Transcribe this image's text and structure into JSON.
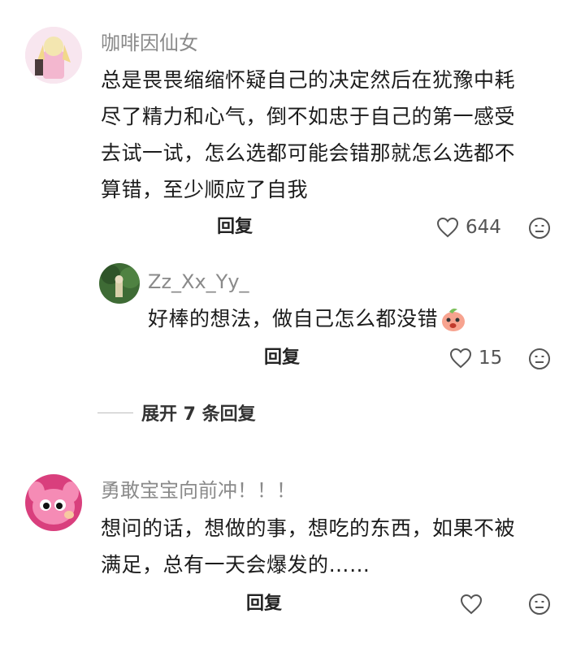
{
  "comments": [
    {
      "username": "咖啡因仙女",
      "text_lines": [
        "总是畏畏缩缩怀疑自己的决定然后在犹豫中耗",
        "尽了精力和心气，倒不如忠于自己的第一感受",
        "去试一试，怎么选都可能会错那就怎么选都不",
        "算错，至少顺应了自我"
      ],
      "reply_label": "回复",
      "likes": "644",
      "reply": {
        "username": "Zz_Xx_Yy_",
        "text": "好棒的想法，做自己怎么都没错",
        "reply_label": "回复",
        "likes": "15"
      },
      "expand_label": "展开 7 条回复"
    },
    {
      "username": "勇敢宝宝向前冲！！！",
      "text_lines": [
        "想问的话，想做的事，想吃的东西，如果不被",
        "满足，总有一天会爆发的……"
      ],
      "reply_label": "回复"
    }
  ],
  "icons": {
    "like": "heart-outline-icon",
    "more": "emoji-face-icon"
  },
  "colors": {
    "username": "#8a8a8a",
    "text": "#1c1c1c",
    "icon": "#555555"
  }
}
